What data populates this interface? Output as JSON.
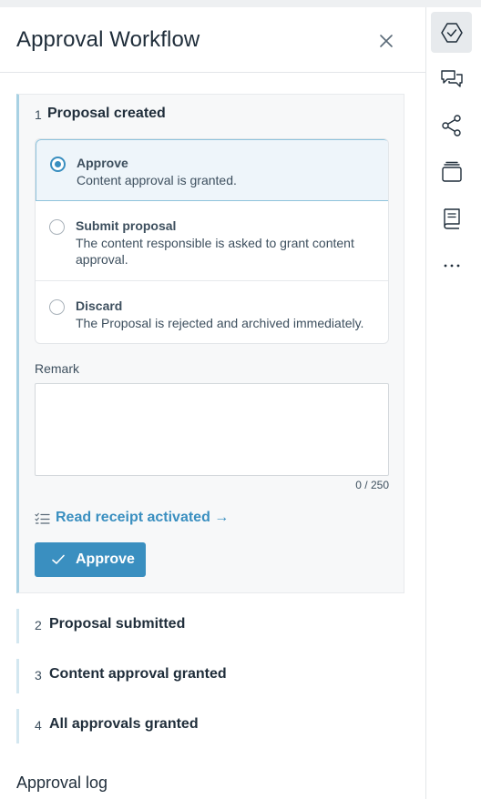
{
  "header": {
    "title": "Approval Workflow",
    "close_icon": "close-icon"
  },
  "steps": [
    {
      "number": "1",
      "title": "Proposal created",
      "expanded": true,
      "options": [
        {
          "title": "Approve",
          "description": "Content approval is granted.",
          "selected": true
        },
        {
          "title": "Submit proposal",
          "description": "The content responsible is asked to grant content approval.",
          "selected": false
        },
        {
          "title": "Discard",
          "description": "The Proposal is rejected and archived immediately.",
          "selected": false
        }
      ],
      "remark": {
        "label": "Remark",
        "value": "",
        "counter": "0 / 250"
      },
      "read_receipt": {
        "icon": "checklist-icon",
        "label": "Read receipt activated →"
      },
      "action": {
        "icon": "check-icon",
        "label": "Approve"
      }
    },
    {
      "number": "2",
      "title": "Proposal submitted",
      "expanded": false
    },
    {
      "number": "3",
      "title": "Content approval granted",
      "expanded": false
    },
    {
      "number": "4",
      "title": "All approvals granted",
      "expanded": false
    }
  ],
  "approval_log": {
    "title": "Approval log"
  },
  "rail": {
    "items": [
      {
        "icon": "approval-hexagon-icon",
        "active": true
      },
      {
        "icon": "comments-icon",
        "active": false
      },
      {
        "icon": "share-nodes-icon",
        "active": false
      },
      {
        "icon": "versions-stack-icon",
        "active": false
      },
      {
        "icon": "book-icon",
        "active": false
      },
      {
        "icon": "more-icon",
        "active": false
      }
    ]
  },
  "colors": {
    "accent": "#3a8fc0",
    "step_active_border": "#a8d1e3",
    "step_inactive_border": "#d3e7f0",
    "selected_option_bg": "#eef5fa",
    "text": "#1f2d3a"
  }
}
